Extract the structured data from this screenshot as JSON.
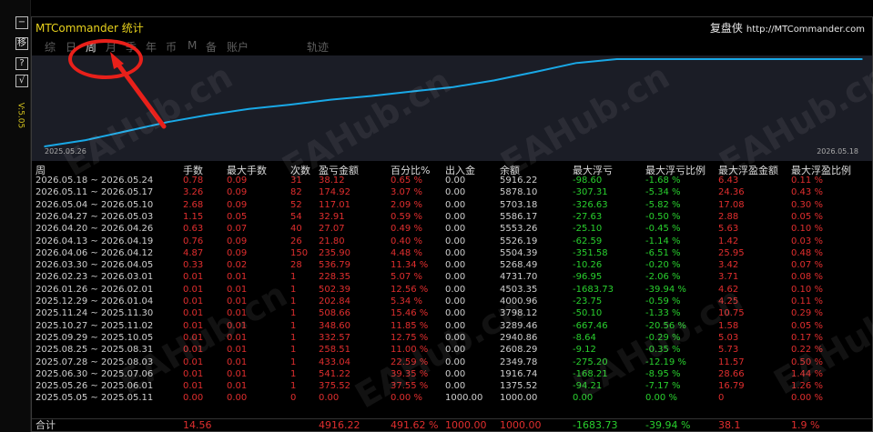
{
  "window": {
    "title": "MTCommander 统计",
    "brand": "复盘侠",
    "brand_url": "http://MTCommander.com"
  },
  "sidebar": {
    "buttons": [
      "−",
      "移",
      "?",
      "√"
    ],
    "version": "V:5.05"
  },
  "tabs": [
    {
      "label": "综"
    },
    {
      "label": "日"
    },
    {
      "label": "周",
      "active": true
    },
    {
      "label": "月"
    },
    {
      "label": "季"
    },
    {
      "label": "年"
    },
    {
      "label": "币"
    },
    {
      "label": "M"
    },
    {
      "label": "备"
    },
    {
      "label": "账户"
    },
    {
      "label": "轨迹"
    }
  ],
  "colors": {
    "line": "#19a8e6",
    "chart_bg": "#1b1d26",
    "profit": "#e02e2e",
    "float": "#29d02e",
    "title": "#e8d21d",
    "highlight": "#e8201a"
  },
  "chart_data": {
    "type": "line",
    "x_start_label": "2025.05.26",
    "x_end_label": "2026.05.18",
    "series": [
      {
        "values": [
          0,
          375.52,
          916.74,
          1458.12,
          1891.16,
          2249.74,
          2508.03,
          2805.0,
          3027.86,
          3305.66,
          3564.57,
          3967.57,
          4469.96,
          5006.75,
          5242.14,
          5242.14,
          5242.14,
          5242.14,
          5242.14,
          5242.14,
          5242.14
        ]
      },
      {
        "values": [
          0,
          0,
          0,
          0,
          0,
          0,
          0,
          0,
          0,
          0,
          0,
          0,
          0,
          0,
          0,
          0,
          0,
          0,
          0,
          0,
          0
        ]
      }
    ],
    "note": ""
  },
  "table": {
    "headers": [
      "周",
      "手数",
      "最大手数",
      "次数",
      "盈亏金额",
      "百分比%",
      "出入金",
      "余额",
      "最大浮亏",
      "最大浮亏比例",
      "最大浮盈金额",
      "最大浮盈比例"
    ],
    "rows": [
      [
        "2026.05.18 ~ 2026.05.24",
        "0.78",
        "0.09",
        "31",
        "38.12",
        "0.65 %",
        "0.00",
        "5916.22",
        "-98.60",
        "-1.68 %",
        "6.43",
        "0.11 %"
      ],
      [
        "2026.05.11 ~ 2026.05.17",
        "3.26",
        "0.09",
        "82",
        "174.92",
        "3.07 %",
        "0.00",
        "5878.10",
        "-307.31",
        "-5.34 %",
        "24.36",
        "0.43 %"
      ],
      [
        "2026.05.04 ~ 2026.05.10",
        "2.68",
        "0.09",
        "52",
        "117.01",
        "2.09 %",
        "0.00",
        "5703.18",
        "-326.63",
        "-5.82 %",
        "17.08",
        "0.30 %"
      ],
      [
        "2026.04.27 ~ 2026.05.03",
        "1.15",
        "0.05",
        "54",
        "32.91",
        "0.59 %",
        "0.00",
        "5586.17",
        "-27.63",
        "-0.50 %",
        "2.88",
        "0.05 %"
      ],
      [
        "2026.04.20 ~ 2026.04.26",
        "0.63",
        "0.07",
        "40",
        "27.07",
        "0.49 %",
        "0.00",
        "5553.26",
        "-25.10",
        "-0.45 %",
        "5.63",
        "0.10 %"
      ],
      [
        "2026.04.13 ~ 2026.04.19",
        "0.76",
        "0.09",
        "26",
        "21.80",
        "0.40 %",
        "0.00",
        "5526.19",
        "-62.59",
        "-1.14 %",
        "1.42",
        "0.03 %"
      ],
      [
        "2026.04.06 ~ 2026.04.12",
        "4.87",
        "0.09",
        "150",
        "235.90",
        "4.48 %",
        "0.00",
        "5504.39",
        "-351.58",
        "-6.51 %",
        "25.95",
        "0.48 %"
      ],
      [
        "2026.03.30 ~ 2026.04.05",
        "0.33",
        "0.02",
        "28",
        "536.79",
        "11.34 %",
        "0.00",
        "5268.49",
        "-10.26",
        "-0.20 %",
        "3.42",
        "0.07 %"
      ],
      [
        "2026.02.23 ~ 2026.03.01",
        "0.01",
        "0.01",
        "1",
        "228.35",
        "5.07 %",
        "0.00",
        "4731.70",
        "-96.95",
        "-2.06 %",
        "3.71",
        "0.08 %"
      ],
      [
        "2026.01.26 ~ 2026.02.01",
        "0.01",
        "0.01",
        "1",
        "502.39",
        "12.56 %",
        "0.00",
        "4503.35",
        "-1683.73",
        "-39.94 %",
        "4.62",
        "0.10 %"
      ],
      [
        "2025.12.29 ~ 2026.01.04",
        "0.01",
        "0.01",
        "1",
        "202.84",
        "5.34 %",
        "0.00",
        "4000.96",
        "-23.75",
        "-0.59 %",
        "4.25",
        "0.11 %"
      ],
      [
        "2025.11.24 ~ 2025.11.30",
        "0.01",
        "0.01",
        "1",
        "508.66",
        "15.46 %",
        "0.00",
        "3798.12",
        "-50.10",
        "-1.33 %",
        "10.75",
        "0.29 %"
      ],
      [
        "2025.10.27 ~ 2025.11.02",
        "0.01",
        "0.01",
        "1",
        "348.60",
        "11.85 %",
        "0.00",
        "3289.46",
        "-667.46",
        "-20.56 %",
        "1.58",
        "0.05 %"
      ],
      [
        "2025.09.29 ~ 2025.10.05",
        "0.01",
        "0.01",
        "1",
        "332.57",
        "12.75 %",
        "0.00",
        "2940.86",
        "-8.64",
        "-0.29 %",
        "5.03",
        "0.17 %"
      ],
      [
        "2025.08.25 ~ 2025.08.31",
        "0.01",
        "0.01",
        "1",
        "258.51",
        "11.00 %",
        "0.00",
        "2608.29",
        "-9.12",
        "-0.35 %",
        "5.73",
        "0.22 %"
      ],
      [
        "2025.07.28 ~ 2025.08.03",
        "0.01",
        "0.01",
        "1",
        "433.04",
        "22.59 %",
        "0.00",
        "2349.78",
        "-275.20",
        "-12.19 %",
        "11.57",
        "0.50 %"
      ],
      [
        "2025.06.30 ~ 2025.07.06",
        "0.01",
        "0.01",
        "1",
        "541.22",
        "39.35 %",
        "0.00",
        "1916.74",
        "-168.21",
        "-8.95 %",
        "28.66",
        "1.44 %"
      ],
      [
        "2025.05.26 ~ 2025.06.01",
        "0.01",
        "0.01",
        "1",
        "375.52",
        "37.55 %",
        "0.00",
        "1375.52",
        "-94.21",
        "-7.17 %",
        "16.79",
        "1.26 %"
      ],
      [
        "2025.05.05 ~ 2025.05.11",
        "0.00",
        "0.00",
        "0",
        "0.00",
        "0.00 %",
        "1000.00",
        "1000.00",
        "0.00",
        "0.00 %",
        "0",
        "0.00 %"
      ]
    ],
    "total": {
      "label": "合计",
      "lots": "14.56",
      "pnl": "4916.22",
      "pct": "491.62 %",
      "deposit": "1000.00",
      "balance": "1000.00",
      "max_float_loss": "-1683.73",
      "max_float_loss_pct": "-39.94 %",
      "max_float_profit": "38.1",
      "max_float_profit_pct": "1.9 %"
    }
  },
  "watermark": "EAHub.cn"
}
